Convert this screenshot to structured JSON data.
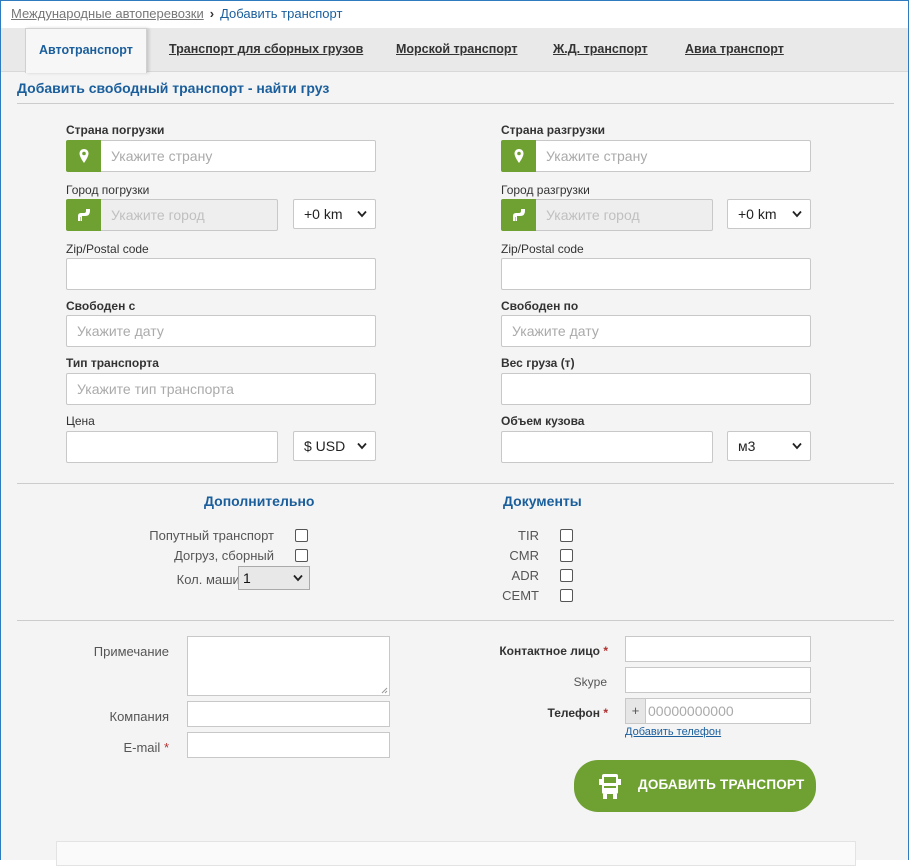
{
  "breadcrumb": {
    "parent": "Международные автоперевозки",
    "current": "Добавить транспорт"
  },
  "tabs": [
    "Автотранспорт",
    "Транспорт для сборных грузов",
    "Морской транспорт",
    "Ж.Д. транспорт",
    "Авиа транспорт"
  ],
  "form_title": "Добавить свободный транспорт - найти груз",
  "left": {
    "country_label": "Страна погрузки",
    "country_placeholder": "Укажите страну",
    "city_label": "Город погрузки",
    "city_placeholder": "Укажите город",
    "radius": "+0 km",
    "zip_label": "Zip/Postal code",
    "free_from_label": "Свободен с",
    "date_placeholder": "Укажите дату",
    "vehicle_type_label": "Тип транспорта",
    "vehicle_type_placeholder": "Укажите тип транспорта",
    "price_label": "Цена",
    "currency": "$ USD"
  },
  "right": {
    "country_label": "Страна разгрузки",
    "country_placeholder": "Укажите страну",
    "city_label": "Город разгрузки",
    "city_placeholder": "Укажите город",
    "radius": "+0 km",
    "zip_label": "Zip/Postal code",
    "free_to_label": "Свободен по",
    "date_placeholder": "Укажите дату",
    "weight_label": "Вес груза (т)",
    "volume_label": "Объем кузова",
    "volume_unit": "м3"
  },
  "additional": {
    "title": "Дополнительно",
    "items": [
      "Попутный транспорт",
      "Догруз, сборный"
    ],
    "vehicles_label": "Кол. машин",
    "vehicles_value": "1"
  },
  "documents": {
    "title": "Документы",
    "items": [
      "TIR",
      "CMR",
      "ADR",
      "CEMT"
    ]
  },
  "contact": {
    "note_label": "Примечание",
    "company_label": "Компания",
    "email_label": "E-mail",
    "contact_person_label": "Контактное лицо",
    "skype_label": "Skype",
    "phone_label": "Телефон",
    "phone_prefix": "+",
    "phone_placeholder": "00000000000",
    "add_phone": "Добавить телефон",
    "required_mark": "*"
  },
  "submit_label": "ДОБАВИТЬ ТРАНСПОРТ",
  "colors": {
    "accent_green": "#6fa032",
    "link_blue": "#1a5e9c",
    "frame_blue": "#2e7bbf"
  }
}
